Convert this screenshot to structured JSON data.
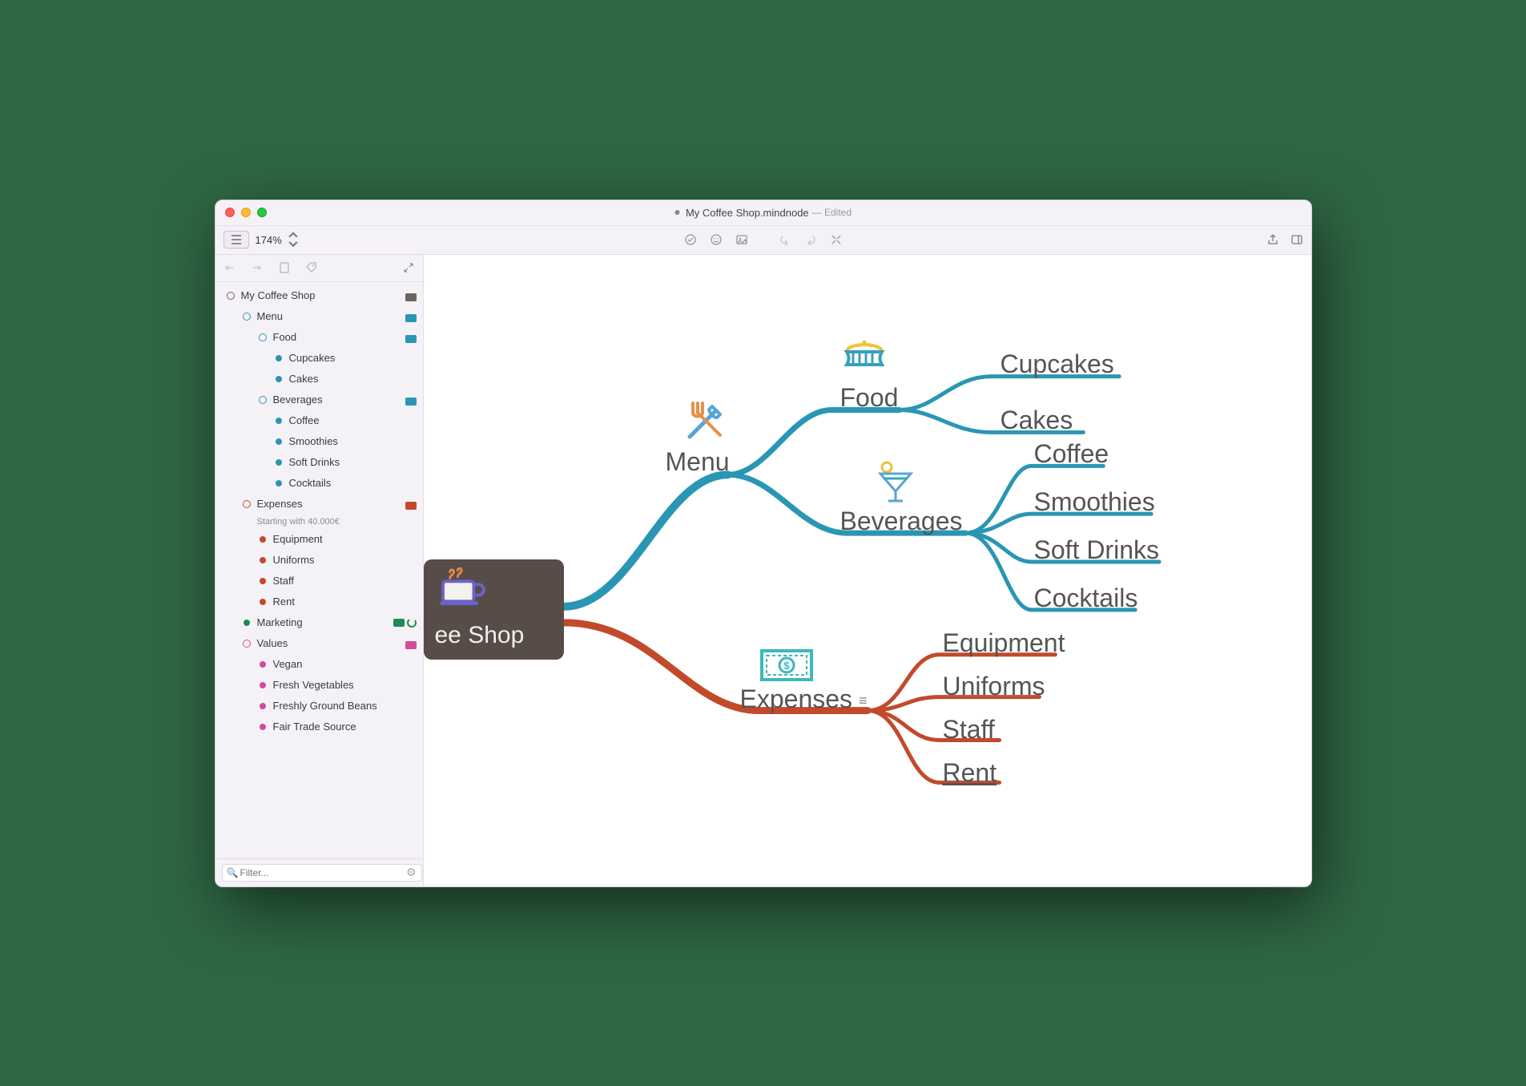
{
  "window": {
    "filename": "My Coffee Shop.mindnode",
    "status": "Edited",
    "zoom": "174%"
  },
  "filter": {
    "placeholder": "Filter..."
  },
  "colors": {
    "root": "#574c48",
    "menu": "#2996b3",
    "expenses": "#c24a2b",
    "marketing": "#1d8a54",
    "values": "#d04c9a"
  },
  "outline": {
    "root": "My Coffee Shop",
    "menu": {
      "label": "Menu",
      "food": {
        "label": "Food",
        "items": [
          "Cupcakes",
          "Cakes"
        ]
      },
      "beverages": {
        "label": "Beverages",
        "items": [
          "Coffee",
          "Smoothies",
          "Soft Drinks",
          "Cocktails"
        ]
      }
    },
    "expenses": {
      "label": "Expenses",
      "note": "Starting with 40.000€",
      "items": [
        "Equipment",
        "Uniforms",
        "Staff",
        "Rent"
      ]
    },
    "marketing": {
      "label": "Marketing"
    },
    "values": {
      "label": "Values",
      "items": [
        "Vegan",
        "Fresh Vegetables",
        "Freshly Ground Beans",
        "Fair Trade Source"
      ]
    }
  },
  "mindmap": {
    "root": "ee Shop",
    "menu": "Menu",
    "food": "Food",
    "beverages": "Beverages",
    "expenses": "Expenses",
    "expenses_glyph": "≡",
    "leaves": {
      "cupcakes": "Cupcakes",
      "cakes": "Cakes",
      "coffee": "Coffee",
      "smoothies": "Smoothies",
      "softdrinks": "Soft Drinks",
      "cocktails": "Cocktails",
      "equipment": "Equipment",
      "uniforms": "Uniforms",
      "staff": "Staff",
      "rent": "Rent"
    }
  }
}
